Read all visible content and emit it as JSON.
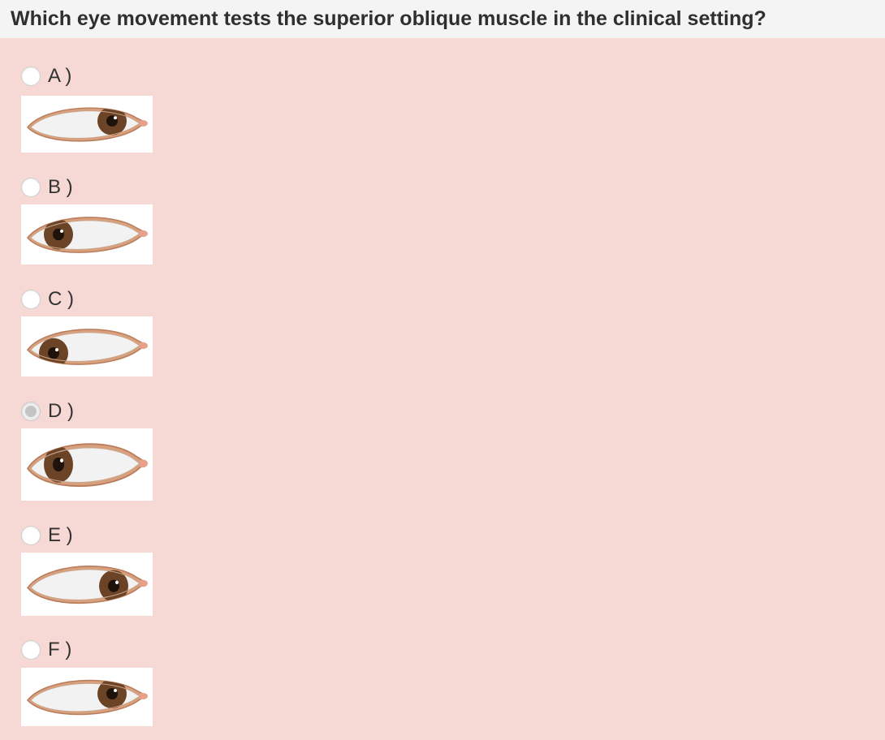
{
  "question": {
    "text": "Which eye movement tests the superior oblique muscle in the clinical setting?"
  },
  "options": [
    {
      "label": "A )",
      "gaze": "up-right",
      "selected": false
    },
    {
      "label": "B )",
      "gaze": "left",
      "selected": false
    },
    {
      "label": "C )",
      "gaze": "down-left",
      "selected": false
    },
    {
      "label": "D )",
      "gaze": "left",
      "selected": true
    },
    {
      "label": "E )",
      "gaze": "right",
      "selected": false
    },
    {
      "label": "F )",
      "gaze": "up-right",
      "selected": false
    }
  ],
  "colors": {
    "header_bg": "#f4f4f4",
    "panel_bg": "#f6d9d4",
    "iris": "#6b4326",
    "eyelid": "#d9a07e",
    "sclera": "#f2f2f2"
  }
}
